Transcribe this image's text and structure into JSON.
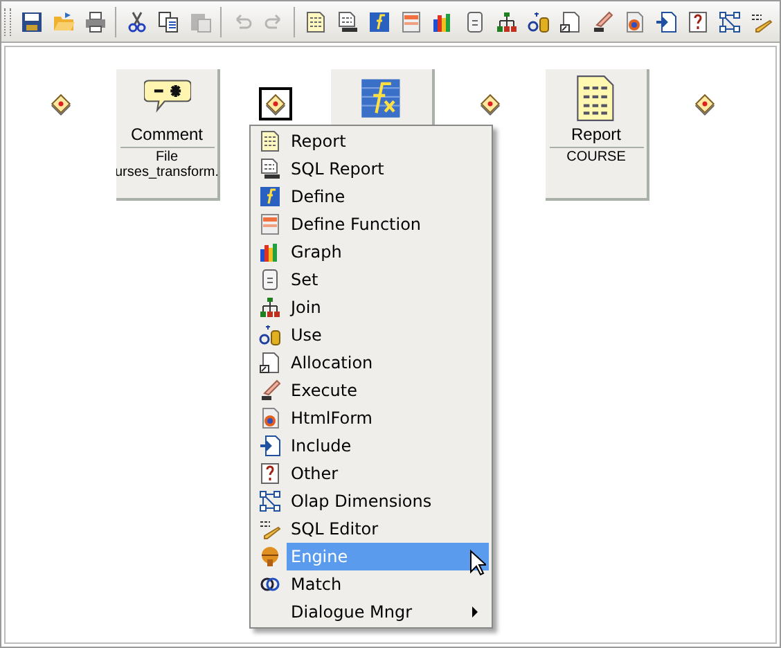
{
  "toolbar": [
    {
      "kind": "save",
      "disabled": false
    },
    {
      "kind": "open",
      "disabled": false
    },
    {
      "kind": "print",
      "disabled": false
    },
    {
      "kind": "separator"
    },
    {
      "kind": "cut",
      "disabled": false
    },
    {
      "kind": "copy",
      "disabled": false
    },
    {
      "kind": "paste",
      "disabled": true
    },
    {
      "kind": "separator"
    },
    {
      "kind": "undo",
      "disabled": true
    },
    {
      "kind": "redo",
      "disabled": true
    },
    {
      "kind": "separator"
    },
    {
      "kind": "report",
      "disabled": false
    },
    {
      "kind": "sqlreport",
      "disabled": false
    },
    {
      "kind": "define",
      "disabled": false
    },
    {
      "kind": "function",
      "disabled": false
    },
    {
      "kind": "graph",
      "disabled": false
    },
    {
      "kind": "set",
      "disabled": false
    },
    {
      "kind": "join",
      "disabled": false
    },
    {
      "kind": "use",
      "disabled": false
    },
    {
      "kind": "allocation",
      "disabled": false
    },
    {
      "kind": "execute",
      "disabled": false
    },
    {
      "kind": "htmlform",
      "disabled": false
    },
    {
      "kind": "include",
      "disabled": false
    },
    {
      "kind": "other",
      "disabled": false
    },
    {
      "kind": "olap",
      "disabled": false
    },
    {
      "kind": "sqleditor",
      "disabled": false
    }
  ],
  "canvas": {
    "nodes": [
      {
        "kind": "connector",
        "selected": false
      },
      {
        "kind": "card",
        "title": "Comment",
        "lines": [
          "File",
          "urses_transform."
        ]
      },
      {
        "kind": "connector",
        "selected": true
      },
      {
        "kind": "card"
      },
      {
        "kind": "connector",
        "selected": false
      },
      {
        "kind": "card",
        "title": "Report",
        "lines": [
          "COURSE"
        ]
      },
      {
        "kind": "connector",
        "selected": false
      }
    ]
  },
  "context_menu": {
    "items": [
      {
        "label": "Report",
        "selected": false
      },
      {
        "label": "SQL Report",
        "selected": false
      },
      {
        "label": "Define",
        "selected": false
      },
      {
        "label": "Define Function",
        "selected": false
      },
      {
        "label": "Graph",
        "selected": false
      },
      {
        "label": "Set",
        "selected": false
      },
      {
        "label": "Join",
        "selected": false
      },
      {
        "label": "Use",
        "selected": false
      },
      {
        "label": "Allocation",
        "selected": false
      },
      {
        "label": "Execute",
        "selected": false
      },
      {
        "label": "HtmlForm",
        "selected": false
      },
      {
        "label": "Include",
        "selected": false
      },
      {
        "label": "Other",
        "selected": false
      },
      {
        "label": "Olap Dimensions",
        "selected": false
      },
      {
        "label": "SQL Editor",
        "selected": false
      },
      {
        "label": "Engine",
        "selected": true
      },
      {
        "label": "Match",
        "selected": false
      },
      {
        "label": "Dialogue Mngr",
        "selected": false,
        "submenu": true
      }
    ]
  }
}
